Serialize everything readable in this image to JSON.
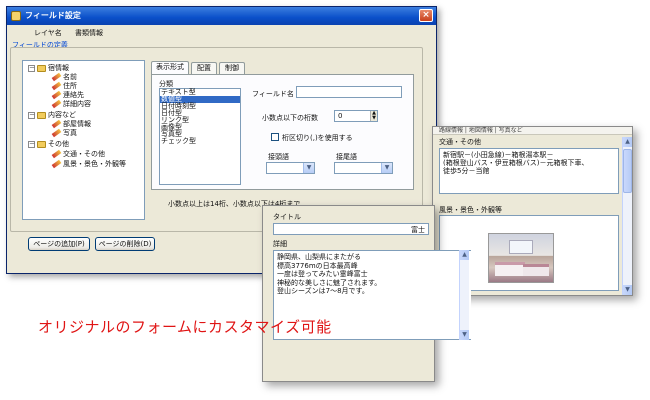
{
  "window": {
    "title": "フィールド設定",
    "close_glyph": "×"
  },
  "menu": [
    "レイヤ名",
    "書類情報"
  ],
  "group_label": "フィールドの定義",
  "tree": [
    {
      "label": "宿情報",
      "type": "folder",
      "expander": "－"
    },
    {
      "label": "名前",
      "type": "field"
    },
    {
      "label": "住所",
      "type": "field"
    },
    {
      "label": "連絡先",
      "type": "field"
    },
    {
      "label": "詳細内容",
      "type": "field"
    },
    {
      "label": "内容など",
      "type": "folder",
      "expander": "－"
    },
    {
      "label": "部屋情報",
      "type": "field"
    },
    {
      "label": "写真",
      "type": "field"
    },
    {
      "label": "その他",
      "type": "folder",
      "expander": "－"
    },
    {
      "label": "交通・その他",
      "type": "field"
    },
    {
      "label": "風景・景色・外観等",
      "type": "field"
    }
  ],
  "tabs": [
    {
      "label": "表示形式",
      "active": true
    },
    {
      "label": "配置",
      "active": false
    },
    {
      "label": "制御",
      "active": false
    }
  ],
  "format": {
    "category_label": "分類",
    "types": [
      "テキスト型",
      "数値型",
      "日付時刻型",
      "日付型",
      "リンク型",
      "画像型",
      "写真型",
      "チェック型"
    ],
    "selected_index": 1,
    "field_name_label": "フィールド名",
    "decimal_label": "小数点以下の桁数",
    "decimal_value": "0",
    "separator_label": "桁区切り(,)を使用する",
    "prefix_label": "接頭語",
    "suffix_label": "接尾語",
    "note": "小数点以上は14桁、小数点以下は4桁まで"
  },
  "buttons": {
    "add_page": "ページの追加(P)",
    "delete_page": "ページの削除(D)"
  },
  "panel_detail": {
    "title_label": "タイトル",
    "title_value": "富士",
    "detail_label": "詳細",
    "detail_lines": [
      "静岡県、山梨県にまたがる",
      "標高3776mの日本最高峰",
      "一度は登ってみたい霊峰富士",
      "神秘的な美しさに魅了されます。",
      "登山シーズンは7～8月です。"
    ]
  },
  "panel_info": {
    "header_tabs": "路線情報 | 地図情報 | 写真など",
    "transport_label": "交通・その他",
    "transport_lines": [
      "新宿駅－(小田急線)－箱根湯本駅－",
      "(箱根登山バス・伊豆箱根バス)－元箱根下車、",
      "徒歩5分－当館"
    ],
    "scenery_label": "風景・景色・外観等"
  },
  "caption": "オリジナルのフォームにカスタマイズ可能",
  "colors": {
    "caption": "#e01414",
    "title_bar": "#0a4fc9",
    "selection": "#316ac5"
  }
}
